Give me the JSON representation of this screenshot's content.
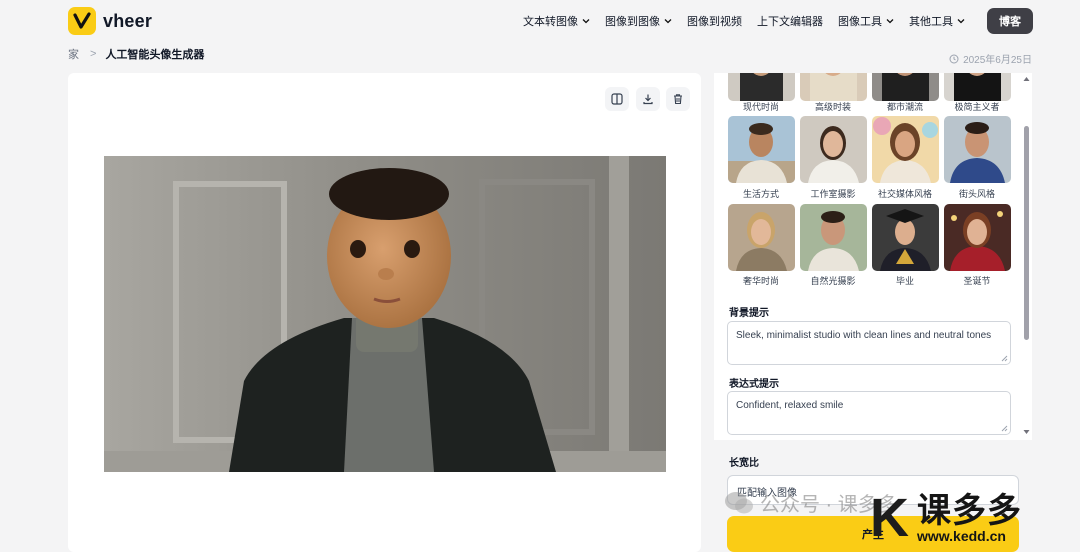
{
  "header": {
    "logo_text": "vheer",
    "nav": [
      {
        "label": "文本转图像",
        "has_dropdown": true
      },
      {
        "label": "图像到图像",
        "has_dropdown": true
      },
      {
        "label": "图像到视频",
        "has_dropdown": false
      },
      {
        "label": "上下文编辑器",
        "has_dropdown": false
      },
      {
        "label": "图像工具",
        "has_dropdown": true
      },
      {
        "label": "其他工具",
        "has_dropdown": true
      }
    ],
    "blog_button": "博客"
  },
  "breadcrumb": {
    "home": "家",
    "separator": ">",
    "current": "人工智能头像生成器"
  },
  "date": "2025年6月25日",
  "canvas": {
    "tools": [
      "compare-icon",
      "download-icon",
      "trash-icon"
    ]
  },
  "panel": {
    "styles": [
      "现代时尚",
      "高级时装",
      "都市潮流",
      "极简主义者",
      "生活方式",
      "工作室摄影",
      "社交媒体风格",
      "街头风格",
      "奢华时尚",
      "自然光摄影",
      "毕业",
      "圣诞节"
    ],
    "background_prompt_label": "背景提示",
    "background_prompt_value": "Sleek, minimalist studio with clean lines and neutral tones",
    "expression_prompt_label": "表达式提示",
    "expression_prompt_value": "Confident, relaxed smile",
    "aspect_ratio_label": "长宽比",
    "aspect_ratio_value": "匹配输入图像",
    "generate_button": "产生"
  },
  "watermark": {
    "wechat_text": "公众号 · 课多多",
    "brand_letter": "K",
    "brand_text": "课多多",
    "brand_url": "www.kedd.cn"
  },
  "colors": {
    "accent": "#facc15",
    "page_bg": "#f4f4f5",
    "button_dark": "#3f3f46"
  }
}
